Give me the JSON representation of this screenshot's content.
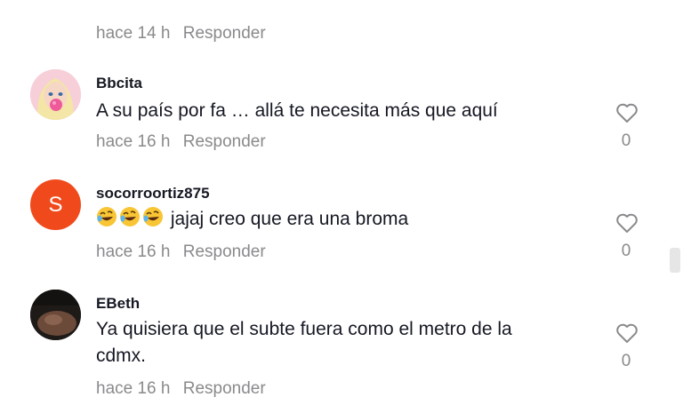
{
  "previous_comment": {
    "time": "hace 14 h",
    "reply": "Responder"
  },
  "comments": [
    {
      "username": "Bbcita",
      "text": "A su país por fa … allá te necesita más que aquí",
      "time": "hace 16 h",
      "reply": "Responder",
      "likes": "0",
      "avatar": "doll-avatar"
    },
    {
      "username": "socorroortiz875",
      "emoji_prefix": [
        "rolling-on-floor-laughing",
        "rolling-on-floor-laughing",
        "rolling-on-floor-laughing"
      ],
      "text": "jajaj creo que era una broma",
      "time": "hace 16 h",
      "reply": "Responder",
      "likes": "0",
      "avatar_letter": "S",
      "avatar_color": "#f04a1c"
    },
    {
      "username": "EBeth",
      "text_line1": "Ya quisiera que el subte fuera como el metro de la",
      "text_line2": "cdmx.",
      "time": "hace 16 h",
      "reply": "Responder",
      "likes": "0",
      "avatar": "dark-photo-avatar"
    }
  ],
  "colors": {
    "text": "#161823",
    "muted": "#8a8a8e",
    "accent": "#f04a1c"
  },
  "icons": {
    "like": "heart-outline-icon"
  }
}
